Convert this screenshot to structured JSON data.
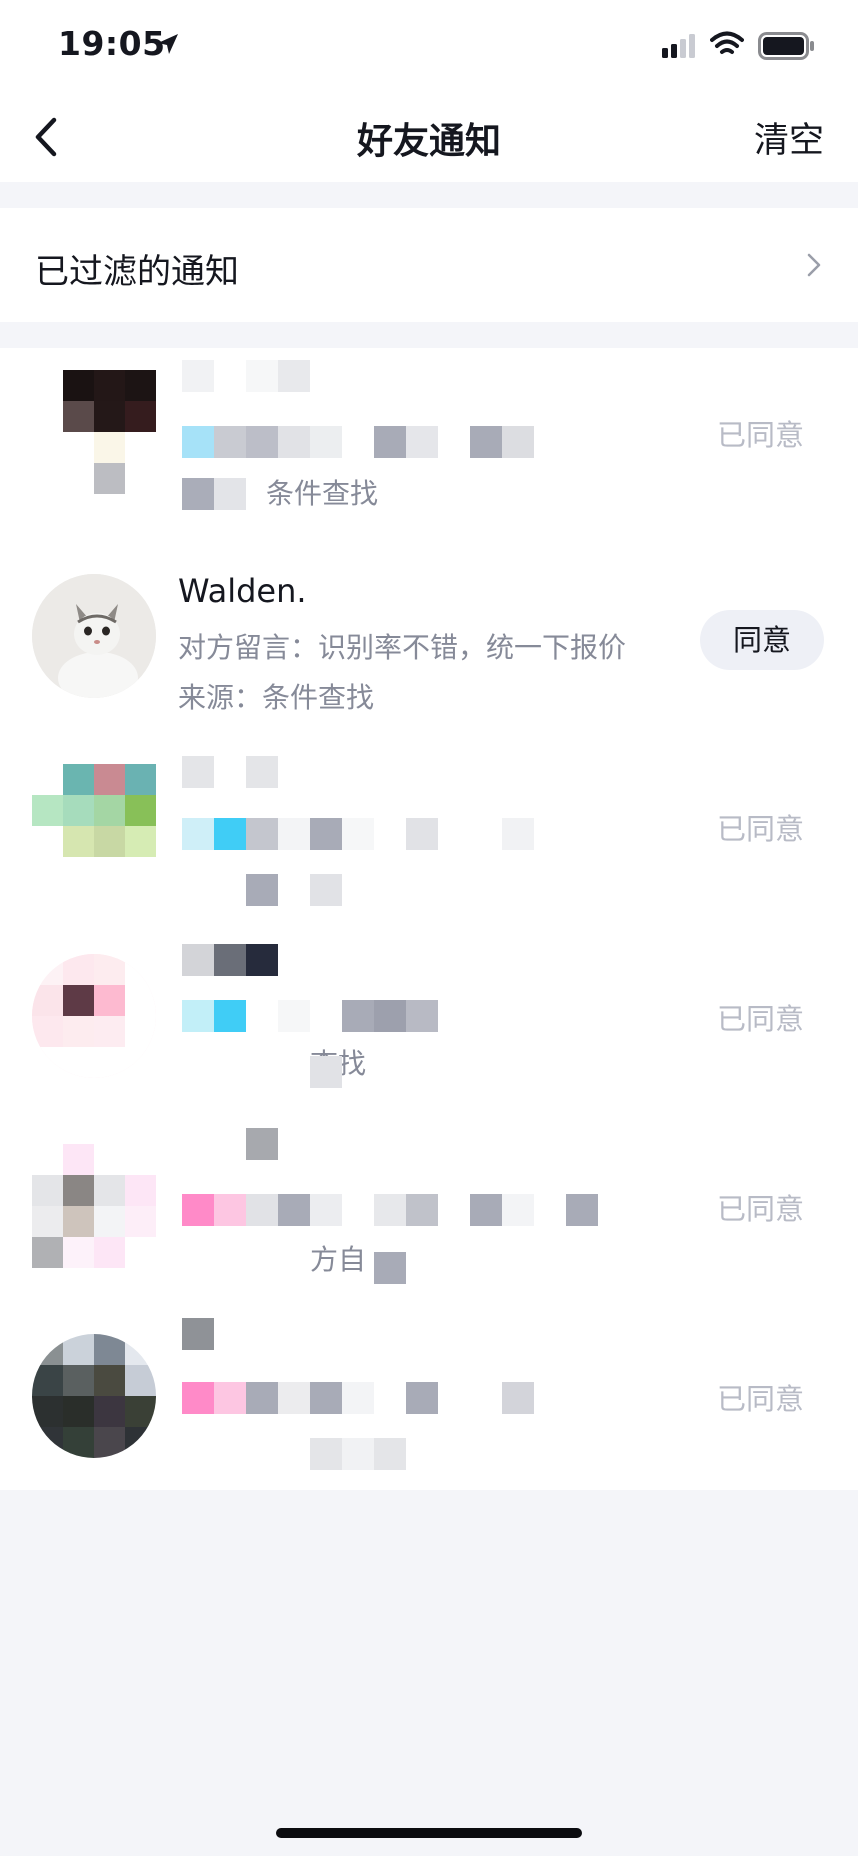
{
  "status_bar": {
    "time": "19:05"
  },
  "nav": {
    "title": "好友通知",
    "action": "清空"
  },
  "filter": {
    "label": "已过滤的通知"
  },
  "items": [
    {
      "name": "",
      "message": "",
      "source": "条件查找",
      "status": "已同意"
    },
    {
      "name": "Walden.",
      "message": "对方留言：识别率不错，统一下报价",
      "source": "来源：条件查找",
      "status": "同意"
    },
    {
      "name": "",
      "message": "",
      "source": "",
      "status": "已同意"
    },
    {
      "name": "",
      "message": "",
      "source": "查找",
      "status": "已同意"
    },
    {
      "name": "",
      "message": "",
      "source": "方自",
      "status": "已同意"
    },
    {
      "name": "",
      "message": "",
      "source": "",
      "status": "已同意"
    }
  ],
  "colors": {
    "background": "#f4f5f9",
    "card": "#ffffff",
    "text_primary": "#15171f",
    "text_secondary": "#868a98",
    "status_muted": "#b8bbc6",
    "agree_button_bg": "#eef0f6"
  },
  "icons": {
    "back": "chevron-left-icon",
    "filter_arrow": "chevron-right-icon",
    "location": "location-arrow-icon",
    "signal": "signal-icon",
    "wifi": "wifi-icon",
    "battery": "battery-icon"
  }
}
